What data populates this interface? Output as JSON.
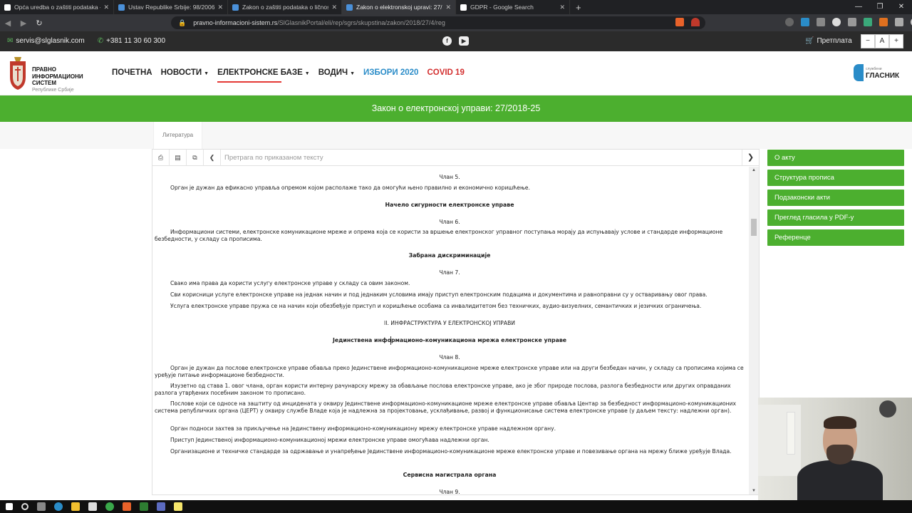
{
  "browser": {
    "tabs": [
      {
        "label": "Opća uredba o zaštiti podataka – Vi",
        "color": "#ffffff",
        "active": false
      },
      {
        "label": "Ustav Republike Srbije: 98/2006-3",
        "color": "#4a90d9",
        "active": false
      },
      {
        "label": "Zakon o zaštiti podataka o ličnosti",
        "color": "#4a90d9",
        "active": false
      },
      {
        "label": "Zakon o elektronskoj upravi: 27/20",
        "color": "#4a90d9",
        "active": true
      },
      {
        "label": "GDPR - Google Search",
        "color": "#ffffff",
        "active": false
      }
    ],
    "url_host": "pravno-informacioni-sistem.rs",
    "url_path": "/SlGlasnikPortal/eli/rep/sgrs/skupstina/zakon/2018/27/4/reg"
  },
  "topbar": {
    "email": "servis@slglasnik.com",
    "phone": "+381 11 30 60 300",
    "subscribe": "Претплата",
    "font_minus": "−",
    "font_a": "A",
    "font_plus": "+"
  },
  "logo": {
    "line1": "ПРАВНО",
    "line2": "ИНФОРМАЦИОНИ",
    "line3": "СИСТЕМ",
    "sub": "Републике Србије"
  },
  "nav": {
    "home": "ПОЧЕТНА",
    "news": "НОВОСТИ",
    "ebases": "ЕЛЕКТРОНСКЕ БАЗЕ",
    "guide": "ВОДИЧ",
    "elections": "ИЗБОРИ 2020",
    "covid": "COVID 19"
  },
  "brand": {
    "small": "службени",
    "name": "ГЛАСНИК"
  },
  "page_title": "Закон о електронској управи: 27/2018-25",
  "subtab": "Литература",
  "viewer": {
    "search_placeholder": "Претрага по приказаном тексту"
  },
  "doc": [
    {
      "text": "Члан 5.",
      "style": "c"
    },
    {
      "text": "Орган је дужан да ефикасно управља опремом којом располаже тако да омогући њено правилно и економично коришћење.",
      "style": "ind"
    },
    {
      "text": "Начело сигурности електронске управе",
      "style": "c b"
    },
    {
      "text": "Члан 6.",
      "style": "c"
    },
    {
      "text": "Информациони системи, електронске комуникационе мреже и опрема која се користи за вршење електронског управног поступања морају да испуњавају услове и стандарде информационе безбедности, у складу са прописима.",
      "style": "ind"
    },
    {
      "text": "Забрана дискриминације",
      "style": "c b"
    },
    {
      "text": "Члан 7.",
      "style": "c"
    },
    {
      "text": "Свако има права да користи услугу електронске управе у складу са овим законом.",
      "style": "ind"
    },
    {
      "text": "Сви корисници услуге електронске управе на једнак начин и под једнаким условима имају приступ електронским подацима и документима и равноправни су у остваривању овог права.",
      "style": "ind"
    },
    {
      "text": "Услуга електронске управе пружа се на начин који обезбеђује приступ и коришћење особама са инвалидитетом без техничких, аудио-визуелних, семантичких и језичких ограничења.",
      "style": "ind"
    },
    {
      "text": "II. ИНФРАСТРУКТУРА У ЕЛЕКТРОНСКОЈ УПРАВИ",
      "style": "c"
    },
    {
      "text": "Јединствена информационо-комуникациона мрежа електронске управе",
      "style": "c b"
    },
    {
      "text": "Члан 8.",
      "style": "c"
    },
    {
      "text": "Орган је дужан да послове електронске управе обавља преко Јединствене информационо-комуникационе мреже електронске управе или на други безбедан начин, у складу са прописима којима се уређује питање информационе безбедности.",
      "style": "ind"
    },
    {
      "text": "Изузетно од става 1. овог члана, орган користи интерну рачунарску мрежу за обављање послова електронске управе, ако је због природе послова, разлога безбедности или других оправданих разлога утврђених посебним законом то прописано.",
      "style": "ind"
    },
    {
      "text": "Послове који се односе на заштиту од инцидената у оквиру Јединствене информационо-комуникационе мреже електронске управе обавља Центар за безбедност информационо-комуникационих система републичких органа (ЦЕРТ) у оквиру службе Владе која је надлежна за пројектовање, усклађивање, развој и функционисање система електронске управе (у даљем тексту: надлежни орган).",
      "style": "ind"
    },
    {
      "text": "Орган подноси захтев за прикључење на Јединствену информационо-комуникациону мрежу електронске управе надлежном органу.",
      "style": "ind"
    },
    {
      "text": "Приступ Јединственој информационо-комуникационој мрежи електронске управе омогућава надлежни орган.",
      "style": "ind"
    },
    {
      "text": "Организационе и техничке стандарде за одржавање и унапређење Јединствене информационо-комуникационе мреже електронске управе и повезивање органа на мрежу ближе уређује Влада.",
      "style": "ind"
    },
    {
      "text": "Сервисна магистрала органа",
      "style": "c b"
    },
    {
      "text": "Члан 9.",
      "style": "c"
    }
  ],
  "sidebar": [
    "О акту",
    "Структура прописа",
    "Подзаконски акти",
    "Преглед гласила у PDF-у",
    "Референце"
  ],
  "colors": {
    "green": "#4caf2f",
    "topbar": "#2b2b2b",
    "blue_nav": "#2a8cc8",
    "red_nav": "#d32f2f"
  }
}
